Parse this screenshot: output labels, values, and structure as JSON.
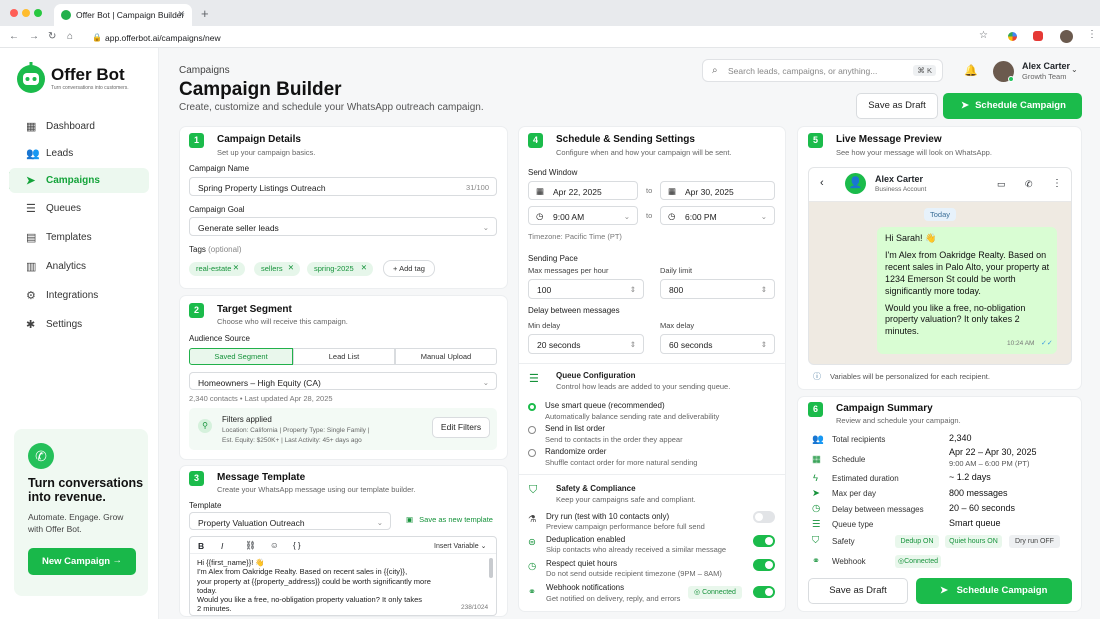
{
  "browser": {
    "tab_title": "Offer Bot | Campaign Builder",
    "url": "app.offerbot.ai/campaigns/new"
  },
  "brand": {
    "name": "Offer Bot",
    "tagline": "Turn conversations into customers."
  },
  "nav": {
    "items": [
      {
        "label": "Dashboard",
        "icon": "grid-icon",
        "active": false
      },
      {
        "label": "Leads",
        "icon": "users-icon",
        "active": false
      },
      {
        "label": "Campaigns",
        "icon": "send-icon",
        "active": true
      },
      {
        "label": "Queues",
        "icon": "queue-icon",
        "active": false
      },
      {
        "label": "Templates",
        "icon": "document-icon",
        "active": false
      },
      {
        "label": "Analytics",
        "icon": "chart-icon",
        "active": false
      },
      {
        "label": "Integrations",
        "icon": "puzzle-icon",
        "active": false
      },
      {
        "label": "Settings",
        "icon": "gear-icon",
        "active": false
      }
    ]
  },
  "promo": {
    "title": "Turn conversations into revenue.",
    "text": "Automate. Engage. Grow with Offer Bot.",
    "button": "New Campaign"
  },
  "header": {
    "breadcrumb": "Campaigns",
    "title": "Campaign Builder",
    "subtitle": "Create, customize and schedule your WhatsApp outreach campaign.",
    "search_placeholder": "Search leads, campaigns, or anything...",
    "search_shortcut": "⌘ K",
    "user_name": "Alex Carter",
    "user_role": "Growth Team",
    "save_draft": "Save as Draft",
    "schedule": "Schedule Campaign"
  },
  "details": {
    "num": "1",
    "title": "Campaign Details",
    "subtitle": "Set up your campaign basics.",
    "name_label": "Campaign Name",
    "name_value": "Spring Property Listings Outreach",
    "name_count": "31/100",
    "goal_label": "Campaign Goal",
    "goal_value": "Generate seller leads",
    "tags_label": "Tags",
    "tags_optional": "(optional)",
    "tags": [
      "real-estate",
      "sellers",
      "spring-2025"
    ],
    "add_tag": "+ Add tag"
  },
  "segment": {
    "num": "2",
    "title": "Target Segment",
    "subtitle": "Choose who will receive this campaign.",
    "source_label": "Audience Source",
    "tabs": [
      "Saved Segment",
      "Lead List",
      "Manual Upload"
    ],
    "segment_value": "Homeowners – High Equity (CA)",
    "meta": "2,340 contacts • Last updated Apr 28, 2025",
    "filters_title": "Filters applied",
    "filters_line1": "Location: California   |   Property Type: Single Family   |",
    "filters_line2": "Est. Equity: $250K+   |   Last Activity: 45+ days ago",
    "edit_filters": "Edit Filters"
  },
  "template": {
    "num": "3",
    "title": "Message Template",
    "subtitle": "Create your WhatsApp message using our template builder.",
    "template_label": "Template",
    "template_value": "Property Valuation Outreach",
    "save_template": "Save as new template",
    "insert_variable": "Insert Variable",
    "body_lines": [
      "Hi {{first_name}}! 👋",
      "I'm Alex from Oakridge Realty. Based on recent sales in {{city}},",
      "your property at {{property_address}} could be worth significantly more",
      "today.",
      "Would you like a free, no-obligation property valuation? It only takes",
      "2 minutes."
    ],
    "char_count": "238/1024"
  },
  "schedule": {
    "num": "4",
    "title": "Schedule & Sending Settings",
    "subtitle": "Configure when and how your campaign will be sent.",
    "window_label": "Send Window",
    "start_date": "Apr 22, 2025",
    "end_date": "Apr 30, 2025",
    "to": "to",
    "start_time": "9:00 AM",
    "end_time": "6:00 PM",
    "timezone": "Timezone: Pacific Time (PT)",
    "pace_label": "Sending Pace",
    "max_hour_label": "Max messages per hour",
    "max_hour": "100",
    "daily_limit_label": "Daily limit",
    "daily_limit": "800",
    "delay_label": "Delay between messages",
    "min_delay_label": "Min delay",
    "min_delay": "20 seconds",
    "max_delay_label": "Max delay",
    "max_delay": "60 seconds"
  },
  "queue": {
    "title": "Queue Configuration",
    "subtitle": "Control how leads are added to your sending queue.",
    "options": [
      {
        "label": "Use smart queue (recommended)",
        "desc": "Automatically balance sending rate and deliverability",
        "selected": true
      },
      {
        "label": "Send in list order",
        "desc": "Send to contacts in the order they appear",
        "selected": false
      },
      {
        "label": "Randomize order",
        "desc": "Shuffle contact order for more natural sending",
        "selected": false
      }
    ]
  },
  "safety": {
    "title": "Safety & Compliance",
    "subtitle": "Keep your campaigns safe and compliant.",
    "items": [
      {
        "label": "Dry run (test with 10 contacts only)",
        "desc": "Preview campaign performance before full send",
        "on": false,
        "icon": "flask-icon"
      },
      {
        "label": "Deduplication enabled",
        "desc": "Skip contacts who already received a similar message",
        "on": true,
        "icon": "dedupe-icon"
      },
      {
        "label": "Respect quiet hours",
        "desc": "Do not send outside recipient timezone (9PM – 8AM)",
        "on": true,
        "icon": "clock-icon"
      },
      {
        "label": "Webhook notifications",
        "desc": "Get notified on delivery, reply, and errors",
        "on": true,
        "icon": "webhook-icon"
      }
    ],
    "connected": "Connected"
  },
  "preview": {
    "num": "5",
    "title": "Live Message Preview",
    "subtitle": "See how your message will look on WhatsApp.",
    "contact": "Alex Carter",
    "contact_type": "Business Account",
    "today": "Today",
    "message_lines": [
      "Hi Sarah! 👋",
      "I'm Alex from Oakridge Realty. Based on recent sales in Palo Alto, your property at 1234 Emerson St could be worth significantly more today.",
      "Would you like a free, no-obligation property valuation? It only takes 2 minutes."
    ],
    "time": "10:24 AM",
    "note": "Variables will be personalized for each recipient."
  },
  "summary": {
    "num": "6",
    "title": "Campaign Summary",
    "subtitle": "Review and schedule your campaign.",
    "rows": [
      {
        "label": "Total recipients",
        "value": "2,340",
        "icon": "users-icon"
      },
      {
        "label": "Schedule",
        "value": "Apr 22 – Apr 30, 2025",
        "sub": "9:00 AM – 6:00 PM (PT)",
        "icon": "calendar-icon"
      },
      {
        "label": "Estimated duration",
        "value": "~ 1.2 days",
        "icon": "bolt-icon"
      },
      {
        "label": "Max per day",
        "value": "800 messages",
        "icon": "send-icon"
      },
      {
        "label": "Delay between messages",
        "value": "20 – 60 seconds",
        "icon": "clock-icon"
      },
      {
        "label": "Queue type",
        "value": "Smart queue",
        "icon": "queue-icon"
      }
    ],
    "safety_label": "Safety",
    "safety_badges": [
      "Dedup ON",
      "Quiet hours ON",
      "Dry run OFF"
    ],
    "webhook_label": "Webhook",
    "webhook_value": "Connected",
    "save_draft": "Save as Draft",
    "schedule": "Schedule Campaign"
  },
  "colors": {
    "accent": "#1bbb4b",
    "accent_light": "#e9f7ec",
    "chat_bg": "#efeae2",
    "bubble": "#d9fdd3"
  }
}
